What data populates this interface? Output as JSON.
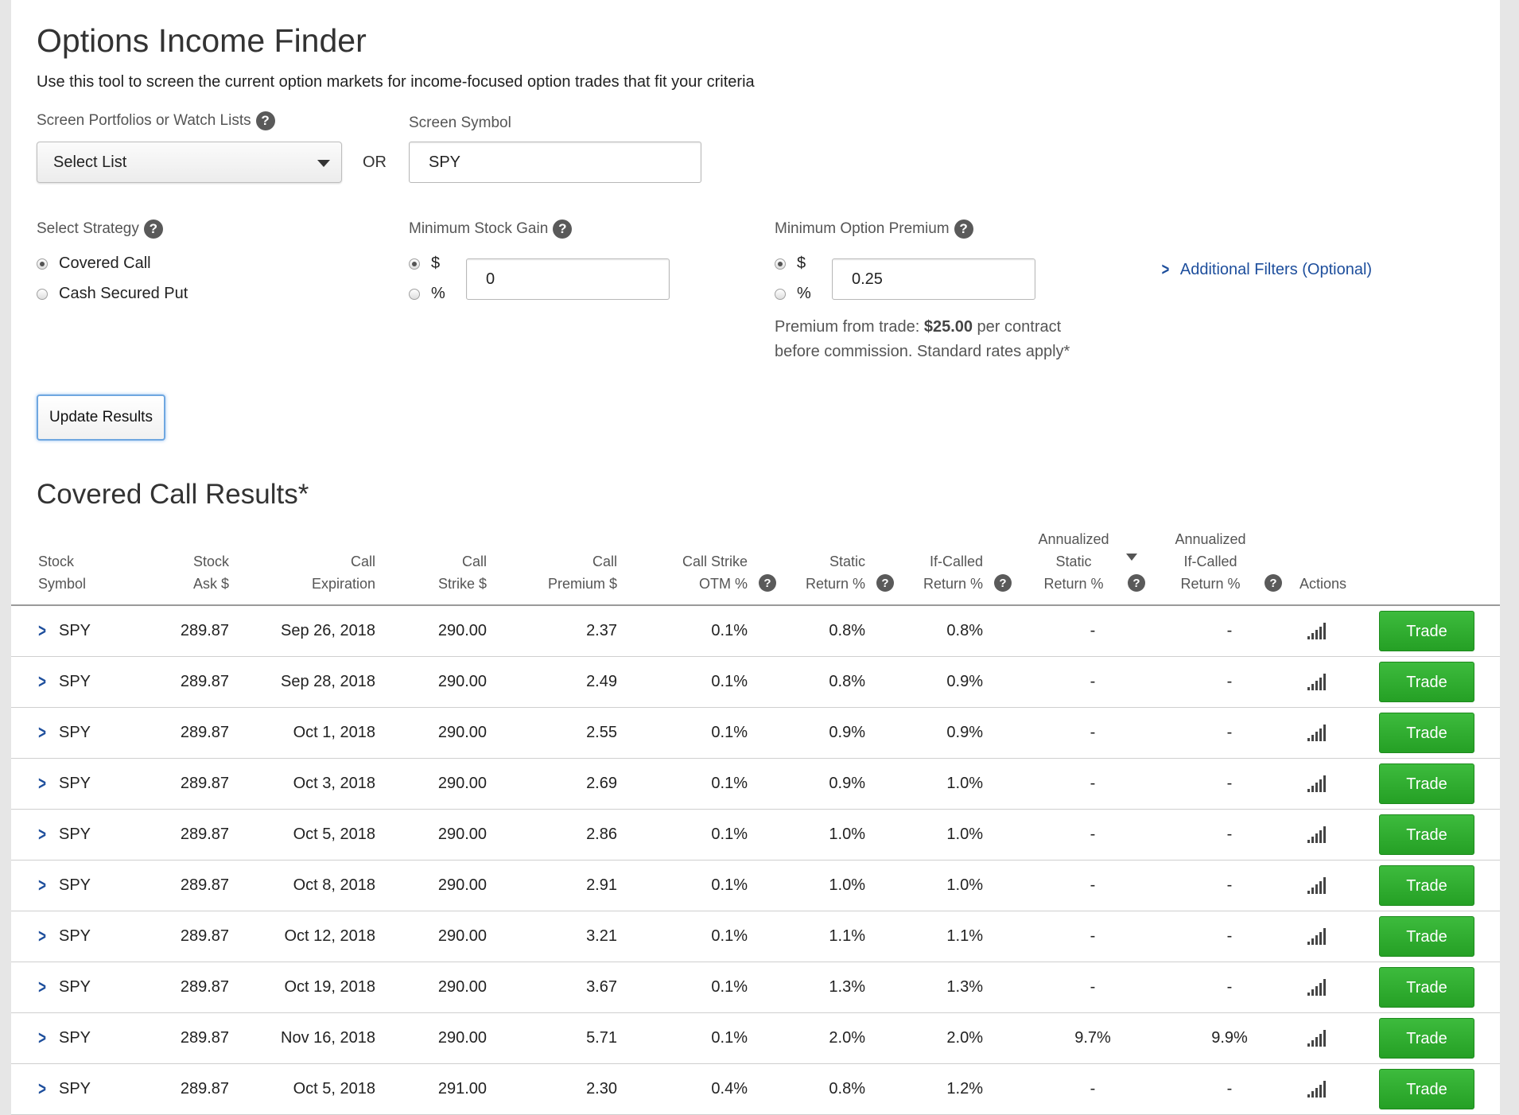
{
  "page": {
    "title": "Options Income Finder",
    "subtitle": "Use this tool to screen the current option markets for income-focused option trades that fit your criteria"
  },
  "screen": {
    "portfolio_label": "Screen Portfolios or Watch Lists",
    "select_value": "Select List",
    "or_label": "OR",
    "symbol_label": "Screen Symbol",
    "symbol_value": "SPY"
  },
  "strategy": {
    "label": "Select Strategy",
    "options": [
      "Covered Call",
      "Cash Secured Put"
    ],
    "selected": "Covered Call"
  },
  "min_stock_gain": {
    "label": "Minimum Stock Gain",
    "unit_dollar": "$",
    "unit_percent": "%",
    "selected_unit": "$",
    "value": "0"
  },
  "min_option_premium": {
    "label": "Minimum Option Premium",
    "unit_dollar": "$",
    "unit_percent": "%",
    "selected_unit": "$",
    "value": "0.25",
    "note_prefix": "Premium from trade: ",
    "note_amount": "$25.00",
    "note_suffix": " per contract",
    "note_line2": "before commission. Standard rates apply*"
  },
  "additional_filters": "Additional Filters (Optional)",
  "update_button": "Update Results",
  "results": {
    "title": "Covered Call Results*",
    "columns": {
      "stock_symbol": [
        "Stock",
        "Symbol"
      ],
      "stock_ask": [
        "Stock",
        "Ask $"
      ],
      "call_expiration": [
        "Call",
        "Expiration"
      ],
      "call_strike": [
        "Call",
        "Strike $"
      ],
      "call_premium": [
        "Call",
        "Premium $"
      ],
      "call_strike_otm": [
        "Call Strike",
        "OTM %"
      ],
      "static_return": [
        "Static",
        "Return %"
      ],
      "if_called_return": [
        "If-Called",
        "Return %"
      ],
      "annualized_static": [
        "Annualized",
        "Static",
        "Return %"
      ],
      "annualized_if_called": [
        "Annualized",
        "If-Called",
        "Return %"
      ],
      "actions": [
        "Actions"
      ]
    },
    "trade_label": "Trade",
    "rows": [
      {
        "symbol": "SPY",
        "ask": "289.87",
        "expiration": "Sep 26, 2018",
        "strike": "290.00",
        "premium": "2.37",
        "otm": "0.1%",
        "static": "0.8%",
        "if_called": "0.8%",
        "ann_static": "-",
        "ann_if_called": "-"
      },
      {
        "symbol": "SPY",
        "ask": "289.87",
        "expiration": "Sep 28, 2018",
        "strike": "290.00",
        "premium": "2.49",
        "otm": "0.1%",
        "static": "0.8%",
        "if_called": "0.9%",
        "ann_static": "-",
        "ann_if_called": "-"
      },
      {
        "symbol": "SPY",
        "ask": "289.87",
        "expiration": "Oct 1, 2018",
        "strike": "290.00",
        "premium": "2.55",
        "otm": "0.1%",
        "static": "0.9%",
        "if_called": "0.9%",
        "ann_static": "-",
        "ann_if_called": "-"
      },
      {
        "symbol": "SPY",
        "ask": "289.87",
        "expiration": "Oct 3, 2018",
        "strike": "290.00",
        "premium": "2.69",
        "otm": "0.1%",
        "static": "0.9%",
        "if_called": "1.0%",
        "ann_static": "-",
        "ann_if_called": "-"
      },
      {
        "symbol": "SPY",
        "ask": "289.87",
        "expiration": "Oct 5, 2018",
        "strike": "290.00",
        "premium": "2.86",
        "otm": "0.1%",
        "static": "1.0%",
        "if_called": "1.0%",
        "ann_static": "-",
        "ann_if_called": "-"
      },
      {
        "symbol": "SPY",
        "ask": "289.87",
        "expiration": "Oct 8, 2018",
        "strike": "290.00",
        "premium": "2.91",
        "otm": "0.1%",
        "static": "1.0%",
        "if_called": "1.0%",
        "ann_static": "-",
        "ann_if_called": "-"
      },
      {
        "symbol": "SPY",
        "ask": "289.87",
        "expiration": "Oct 12, 2018",
        "strike": "290.00",
        "premium": "3.21",
        "otm": "0.1%",
        "static": "1.1%",
        "if_called": "1.1%",
        "ann_static": "-",
        "ann_if_called": "-"
      },
      {
        "symbol": "SPY",
        "ask": "289.87",
        "expiration": "Oct 19, 2018",
        "strike": "290.00",
        "premium": "3.67",
        "otm": "0.1%",
        "static": "1.3%",
        "if_called": "1.3%",
        "ann_static": "-",
        "ann_if_called": "-"
      },
      {
        "symbol": "SPY",
        "ask": "289.87",
        "expiration": "Nov 16, 2018",
        "strike": "290.00",
        "premium": "5.71",
        "otm": "0.1%",
        "static": "2.0%",
        "if_called": "2.0%",
        "ann_static": "9.7%",
        "ann_if_called": "9.9%"
      },
      {
        "symbol": "SPY",
        "ask": "289.87",
        "expiration": "Oct 5, 2018",
        "strike": "291.00",
        "premium": "2.30",
        "otm": "0.4%",
        "static": "0.8%",
        "if_called": "1.2%",
        "ann_static": "-",
        "ann_if_called": "-"
      }
    ]
  },
  "icons": {
    "help": "question-circle-icon",
    "row_expand": "chevron-right-icon",
    "actions": "signal-bars-icon",
    "sort": "sort-down-icon"
  },
  "colors": {
    "link": "#1d4e9c",
    "trade_button": "#2aa82a",
    "update_border": "#6fa7e0"
  }
}
